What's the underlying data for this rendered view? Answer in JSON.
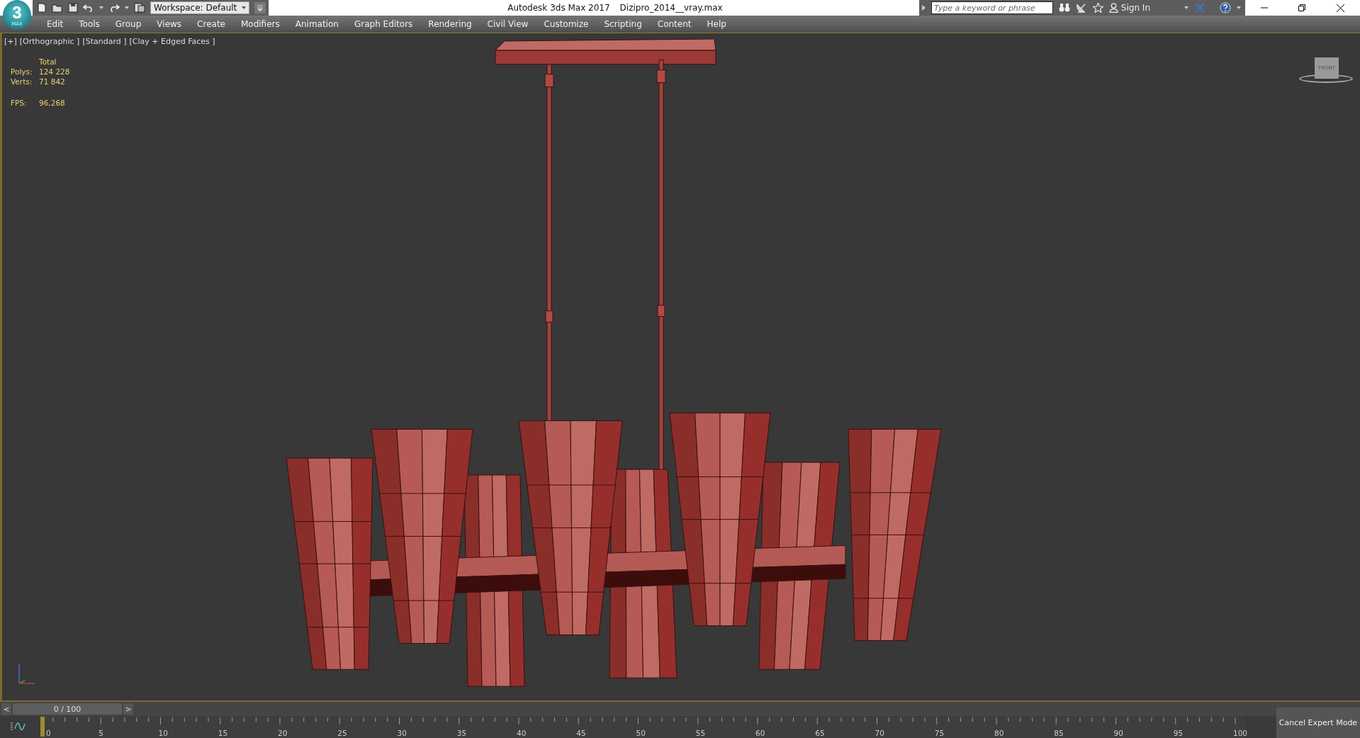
{
  "title_bar": {
    "logo": {
      "glyph": "3",
      "sub": "MAX"
    },
    "workspace": "Workspace: Default",
    "app_title": "Autodesk 3ds Max 2017",
    "file_name": "Dizipro_2014__vray.max",
    "search": {
      "placeholder": "Type a keyword or phrase"
    },
    "sign_in": "Sign In"
  },
  "menu": [
    "Edit",
    "Tools",
    "Group",
    "Views",
    "Create",
    "Modifiers",
    "Animation",
    "Graph Editors",
    "Rendering",
    "Civil View",
    "Customize",
    "Scripting",
    "Content",
    "Help"
  ],
  "viewport": {
    "labels": [
      "[+]",
      "[Orthographic ]",
      "[Standard ]",
      "[Clay + Edged Faces ]"
    ],
    "stats": {
      "header": "Total",
      "rows": [
        {
          "label": "Polys:",
          "value": "124 228"
        },
        {
          "label": "Verts:",
          "value": "71 842"
        }
      ],
      "fps": {
        "label": "FPS:",
        "value": "96,268"
      }
    },
    "viewcube": "FRONT"
  },
  "time_slider": {
    "prev": "<",
    "reading": "0 / 100",
    "next": ">",
    "level": 0
  },
  "track_bar": {
    "ticks": [
      "0",
      "5",
      "10",
      "15",
      "20",
      "25",
      "30",
      "35",
      "40",
      "45",
      "50",
      "55",
      "60",
      "65",
      "70",
      "75",
      "80",
      "85",
      "90",
      "95",
      "100"
    ]
  },
  "cancel_button": "Cancel Expert Mode"
}
